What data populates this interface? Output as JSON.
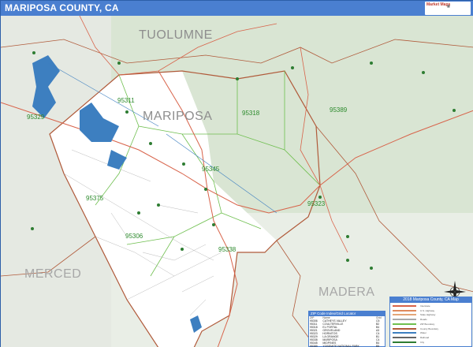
{
  "header": {
    "title": "MARIPOSA COUNTY, CA",
    "brand_name": "Market Maps",
    "brand_colors": {
      "bar": "#4a7fd0",
      "text": "#ffffff"
    }
  },
  "map": {
    "place_labels": [
      {
        "key": "tuolumne",
        "text": "TUOLUMNE"
      },
      {
        "key": "mariposa",
        "text": "MARIPOSA"
      },
      {
        "key": "merced",
        "text": "MERCED"
      },
      {
        "key": "madera",
        "text": "MADERA"
      }
    ],
    "zip_labels": [
      "95311",
      "95329",
      "95318",
      "95389",
      "95345",
      "95375",
      "95323",
      "95306",
      "95338"
    ],
    "colors": {
      "shaded_relief": "#d9e5d3",
      "white_area": "#ffffff",
      "water": "#3d7fc0",
      "county_border": "#b05a3a",
      "zip_border": "#6fbf4f",
      "road_major": "#d8634a",
      "road_minor": "#9a9a9a"
    }
  },
  "zip_index": {
    "title": "ZIP Code Index/Grid Locator",
    "columns": [
      "ZIP",
      "Name",
      "Grid"
    ],
    "rows": [
      [
        "95306",
        "CATHEYS VALLEY",
        "C5"
      ],
      [
        "95311",
        "COULTERVILLE",
        "B2"
      ],
      [
        "95318",
        "EL PORTAL",
        "B4"
      ],
      [
        "95321",
        "GROVELAND",
        "A3"
      ],
      [
        "95323",
        "HORNITOS",
        "C4"
      ],
      [
        "95329",
        "LA GRANGE",
        "B1"
      ],
      [
        "95338",
        "MARIPOSA",
        "C4"
      ],
      [
        "95345",
        "MIDPINES",
        "B4"
      ],
      [
        "95389",
        "YOSEMITE NATIONAL PARK",
        "B5"
      ]
    ]
  },
  "legend": {
    "title": "2018 Mariposa County, CA Map",
    "items": [
      {
        "label": "Interstate",
        "color": "#d8634a"
      },
      {
        "label": "U.S. Highway",
        "color": "#e08a5c"
      },
      {
        "label": "State Highway",
        "color": "#e3a679"
      },
      {
        "label": "Roads",
        "color": "#aaaaaa"
      },
      {
        "label": "ZIP Boundary",
        "color": "#6fbf4f"
      },
      {
        "label": "County Boundary",
        "color": "#b05a3a"
      },
      {
        "label": "Water",
        "color": "#3d7fc0"
      },
      {
        "label": "Railroad",
        "color": "#666666"
      },
      {
        "label": "City",
        "color": "#2e7d32"
      }
    ]
  }
}
